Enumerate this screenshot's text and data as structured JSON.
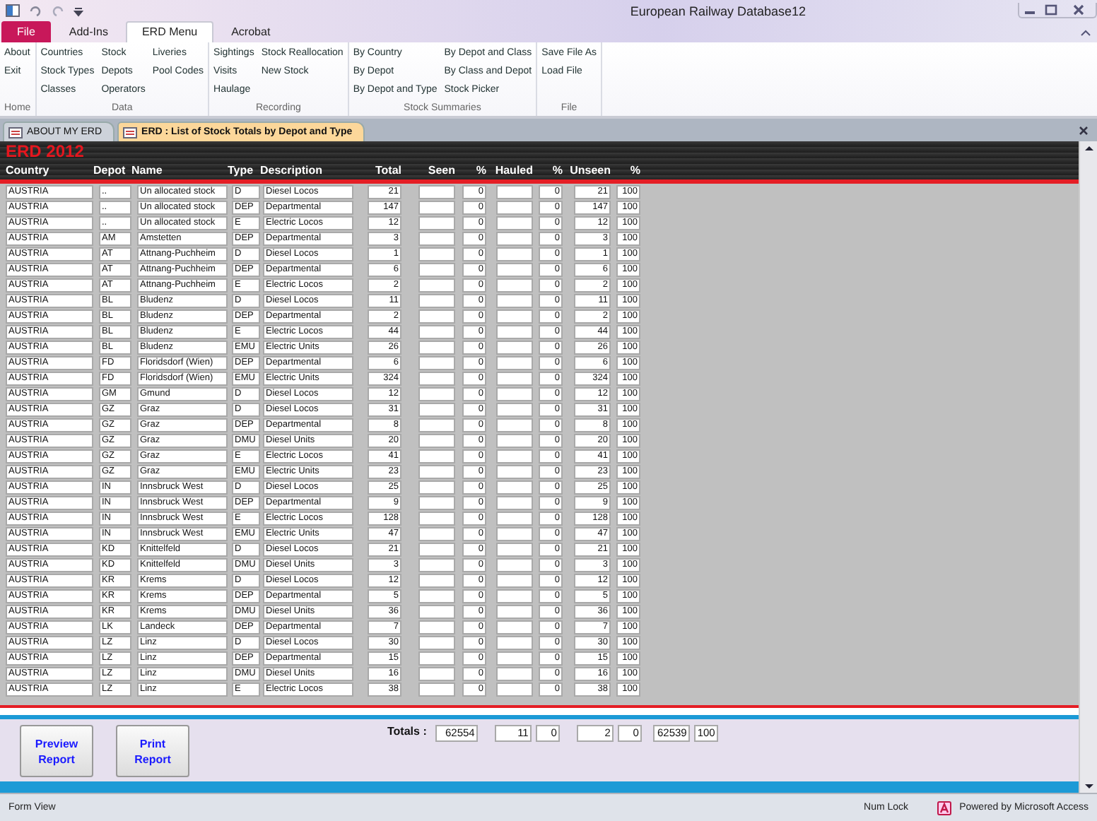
{
  "window": {
    "title": "European Railway Database12"
  },
  "ribbon_tabs": [
    {
      "label": "File",
      "kind": "file",
      "selected": false
    },
    {
      "label": "Add-Ins",
      "kind": "tab",
      "selected": false
    },
    {
      "label": "ERD Menu",
      "kind": "tab",
      "selected": true
    },
    {
      "label": "Acrobat",
      "kind": "tab",
      "selected": false
    }
  ],
  "ribbon_groups": [
    {
      "label": "Home",
      "columns": [
        [
          "About",
          "Exit"
        ]
      ]
    },
    {
      "label": "Data",
      "columns": [
        [
          "Countries",
          "Stock Types",
          "Classes"
        ],
        [
          "Stock",
          "Depots",
          "Operators"
        ],
        [
          "Liveries",
          "Pool Codes"
        ]
      ]
    },
    {
      "label": "Recording",
      "columns": [
        [
          "Sightings",
          "Visits",
          "Haulage"
        ],
        [
          "Stock Reallocation",
          "New Stock"
        ]
      ]
    },
    {
      "label": "Stock Summaries",
      "columns": [
        [
          "By Country",
          "By Depot",
          "By Depot and Type"
        ],
        [
          "By Depot and Class",
          "By Class and Depot",
          "Stock Picker"
        ]
      ]
    },
    {
      "label": "File",
      "columns": [
        [
          "Save File As",
          "Load File"
        ]
      ]
    }
  ],
  "document_tabs": [
    {
      "label": "ABOUT MY ERD",
      "selected": false
    },
    {
      "label": "ERD : List of Stock Totals by Depot and Type",
      "selected": true
    }
  ],
  "form": {
    "brand": "ERD 2012",
    "columns": [
      "Country",
      "Depot",
      "Name",
      "Type",
      "Description",
      "Total",
      "Seen",
      "%",
      "Hauled",
      "%",
      "Unseen",
      "%"
    ],
    "rows": [
      [
        "AUSTRIA",
        "..",
        "Un allocated stock",
        "D",
        "Diesel Locos",
        "21",
        "",
        "0",
        "",
        "0",
        "21",
        "100"
      ],
      [
        "AUSTRIA",
        "..",
        "Un allocated stock",
        "DEP",
        "Departmental",
        "147",
        "",
        "0",
        "",
        "0",
        "147",
        "100"
      ],
      [
        "AUSTRIA",
        "..",
        "Un allocated stock",
        "E",
        "Electric Locos",
        "12",
        "",
        "0",
        "",
        "0",
        "12",
        "100"
      ],
      [
        "AUSTRIA",
        "AM",
        "Amstetten",
        "DEP",
        "Departmental",
        "3",
        "",
        "0",
        "",
        "0",
        "3",
        "100"
      ],
      [
        "AUSTRIA",
        "AT",
        "Attnang-Puchheim",
        "D",
        "Diesel Locos",
        "1",
        "",
        "0",
        "",
        "0",
        "1",
        "100"
      ],
      [
        "AUSTRIA",
        "AT",
        "Attnang-Puchheim",
        "DEP",
        "Departmental",
        "6",
        "",
        "0",
        "",
        "0",
        "6",
        "100"
      ],
      [
        "AUSTRIA",
        "AT",
        "Attnang-Puchheim",
        "E",
        "Electric Locos",
        "2",
        "",
        "0",
        "",
        "0",
        "2",
        "100"
      ],
      [
        "AUSTRIA",
        "BL",
        "Bludenz",
        "D",
        "Diesel Locos",
        "11",
        "",
        "0",
        "",
        "0",
        "11",
        "100"
      ],
      [
        "AUSTRIA",
        "BL",
        "Bludenz",
        "DEP",
        "Departmental",
        "2",
        "",
        "0",
        "",
        "0",
        "2",
        "100"
      ],
      [
        "AUSTRIA",
        "BL",
        "Bludenz",
        "E",
        "Electric Locos",
        "44",
        "",
        "0",
        "",
        "0",
        "44",
        "100"
      ],
      [
        "AUSTRIA",
        "BL",
        "Bludenz",
        "EMU",
        "Electric Units",
        "26",
        "",
        "0",
        "",
        "0",
        "26",
        "100"
      ],
      [
        "AUSTRIA",
        "FD",
        "Floridsdorf (Wien)",
        "DEP",
        "Departmental",
        "6",
        "",
        "0",
        "",
        "0",
        "6",
        "100"
      ],
      [
        "AUSTRIA",
        "FD",
        "Floridsdorf (Wien)",
        "EMU",
        "Electric Units",
        "324",
        "",
        "0",
        "",
        "0",
        "324",
        "100"
      ],
      [
        "AUSTRIA",
        "GM",
        "Gmund",
        "D",
        "Diesel Locos",
        "12",
        "",
        "0",
        "",
        "0",
        "12",
        "100"
      ],
      [
        "AUSTRIA",
        "GZ",
        "Graz",
        "D",
        "Diesel Locos",
        "31",
        "",
        "0",
        "",
        "0",
        "31",
        "100"
      ],
      [
        "AUSTRIA",
        "GZ",
        "Graz",
        "DEP",
        "Departmental",
        "8",
        "",
        "0",
        "",
        "0",
        "8",
        "100"
      ],
      [
        "AUSTRIA",
        "GZ",
        "Graz",
        "DMU",
        "Diesel Units",
        "20",
        "",
        "0",
        "",
        "0",
        "20",
        "100"
      ],
      [
        "AUSTRIA",
        "GZ",
        "Graz",
        "E",
        "Electric Locos",
        "41",
        "",
        "0",
        "",
        "0",
        "41",
        "100"
      ],
      [
        "AUSTRIA",
        "GZ",
        "Graz",
        "EMU",
        "Electric Units",
        "23",
        "",
        "0",
        "",
        "0",
        "23",
        "100"
      ],
      [
        "AUSTRIA",
        "IN",
        "Innsbruck West",
        "D",
        "Diesel Locos",
        "25",
        "",
        "0",
        "",
        "0",
        "25",
        "100"
      ],
      [
        "AUSTRIA",
        "IN",
        "Innsbruck West",
        "DEP",
        "Departmental",
        "9",
        "",
        "0",
        "",
        "0",
        "9",
        "100"
      ],
      [
        "AUSTRIA",
        "IN",
        "Innsbruck West",
        "E",
        "Electric Locos",
        "128",
        "",
        "0",
        "",
        "0",
        "128",
        "100"
      ],
      [
        "AUSTRIA",
        "IN",
        "Innsbruck West",
        "EMU",
        "Electric Units",
        "47",
        "",
        "0",
        "",
        "0",
        "47",
        "100"
      ],
      [
        "AUSTRIA",
        "KD",
        "Knittelfeld",
        "D",
        "Diesel Locos",
        "21",
        "",
        "0",
        "",
        "0",
        "21",
        "100"
      ],
      [
        "AUSTRIA",
        "KD",
        "Knittelfeld",
        "DMU",
        "Diesel Units",
        "3",
        "",
        "0",
        "",
        "0",
        "3",
        "100"
      ],
      [
        "AUSTRIA",
        "KR",
        "Krems",
        "D",
        "Diesel Locos",
        "12",
        "",
        "0",
        "",
        "0",
        "12",
        "100"
      ],
      [
        "AUSTRIA",
        "KR",
        "Krems",
        "DEP",
        "Departmental",
        "5",
        "",
        "0",
        "",
        "0",
        "5",
        "100"
      ],
      [
        "AUSTRIA",
        "KR",
        "Krems",
        "DMU",
        "Diesel Units",
        "36",
        "",
        "0",
        "",
        "0",
        "36",
        "100"
      ],
      [
        "AUSTRIA",
        "LK",
        "Landeck",
        "DEP",
        "Departmental",
        "7",
        "",
        "0",
        "",
        "0",
        "7",
        "100"
      ],
      [
        "AUSTRIA",
        "LZ",
        "Linz",
        "D",
        "Diesel Locos",
        "30",
        "",
        "0",
        "",
        "0",
        "30",
        "100"
      ],
      [
        "AUSTRIA",
        "LZ",
        "Linz",
        "DEP",
        "Departmental",
        "15",
        "",
        "0",
        "",
        "0",
        "15",
        "100"
      ],
      [
        "AUSTRIA",
        "LZ",
        "Linz",
        "DMU",
        "Diesel Units",
        "16",
        "",
        "0",
        "",
        "0",
        "16",
        "100"
      ],
      [
        "AUSTRIA",
        "LZ",
        "Linz",
        "E",
        "Electric Locos",
        "38",
        "",
        "0",
        "",
        "0",
        "38",
        "100"
      ]
    ],
    "buttons": [
      "Preview Report",
      "Print Report"
    ],
    "totals_label": "Totals :",
    "totals": [
      "62554",
      "11",
      "0",
      "2",
      "0",
      "62539",
      "100"
    ]
  },
  "status_bar": {
    "view": "Form View",
    "num_lock": "Num Lock",
    "powered_by": "Powered by Microsoft Access"
  }
}
